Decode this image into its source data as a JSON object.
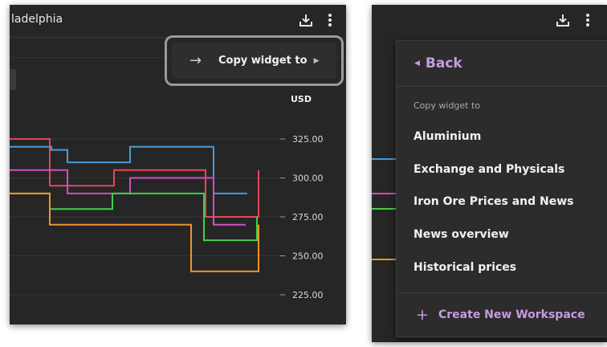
{
  "left_panel": {
    "title": "ladelphia",
    "currency": "USD",
    "callout": {
      "label": "Copy widget to",
      "arrow_icon": "arrow-right-icon",
      "caret_icon": "caret-right-icon"
    },
    "icons": {
      "download": "download-icon",
      "more": "kebab-menu-icon"
    }
  },
  "chart_data": {
    "type": "line",
    "ylabel": "USD",
    "ylim": [
      215,
      340
    ],
    "yticks": [
      "325.00",
      "300.00",
      "275.00",
      "250.00",
      "225.00"
    ],
    "series": [
      {
        "color": "#4a9bd8",
        "points": [
          [
            0,
            320
          ],
          [
            48,
            320
          ],
          [
            52,
            318
          ],
          [
            68,
            318
          ],
          [
            72,
            310
          ],
          [
            148,
            310
          ],
          [
            150,
            320
          ],
          [
            252,
            320
          ],
          [
            254,
            290
          ],
          [
            296,
            290
          ]
        ]
      },
      {
        "color": "#e04a5a",
        "points": [
          [
            0,
            325
          ],
          [
            48,
            325
          ],
          [
            50,
            295
          ],
          [
            128,
            295
          ],
          [
            130,
            305
          ],
          [
            242,
            305
          ],
          [
            244,
            275
          ],
          [
            306,
            275
          ],
          [
            310,
            305
          ]
        ]
      },
      {
        "color": "#d44cc2",
        "points": [
          [
            0,
            305
          ],
          [
            70,
            305
          ],
          [
            72,
            290
          ],
          [
            148,
            290
          ],
          [
            150,
            300
          ],
          [
            252,
            300
          ],
          [
            254,
            270
          ],
          [
            294,
            270
          ]
        ]
      },
      {
        "color": "#3fd14a",
        "points": [
          [
            0,
            290
          ],
          [
            48,
            290
          ],
          [
            50,
            280
          ],
          [
            126,
            280
          ],
          [
            128,
            290
          ],
          [
            240,
            290
          ],
          [
            242,
            260
          ],
          [
            306,
            260
          ],
          [
            308,
            275
          ]
        ]
      },
      {
        "color": "#f0932a",
        "points": [
          [
            0,
            290
          ],
          [
            48,
            290
          ],
          [
            50,
            270
          ],
          [
            224,
            270
          ],
          [
            226,
            240
          ],
          [
            306,
            240
          ],
          [
            310,
            270
          ]
        ]
      }
    ]
  },
  "right_panel": {
    "back_label": "Back",
    "section_label": "Copy widget to",
    "items": [
      "Aluminium",
      "Exchange and Physicals",
      "Iron Ore Prices and News",
      "News overview",
      "Historical prices"
    ],
    "create_label": "Create New Workspace",
    "background_series_colors": [
      "#4a9bd8",
      "#d44cc2",
      "#3fd14a",
      "#f0932a"
    ]
  },
  "colors": {
    "accent": "#c79be0",
    "panel_bg": "#262626"
  }
}
